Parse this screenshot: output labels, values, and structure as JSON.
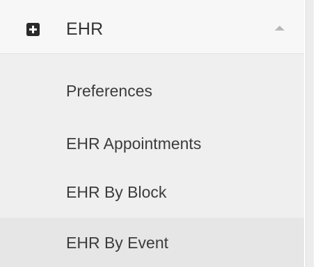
{
  "menu": {
    "group": {
      "icon": "medical-cross-icon",
      "label": "EHR",
      "expanded": true,
      "toggle_icon": "caret-up-icon"
    },
    "items": [
      {
        "label": "Preferences"
      },
      {
        "label": "EHR Appointments"
      },
      {
        "label": "EHR By Block"
      },
      {
        "label": "EHR By Event"
      }
    ]
  },
  "colors": {
    "header_background": "#f7f7f7",
    "submenu_background": "#efefef",
    "active_item_background": "#e6e6e6",
    "text": "#333333",
    "icon": "#2b2b2b",
    "caret": "#b8b8b8"
  }
}
